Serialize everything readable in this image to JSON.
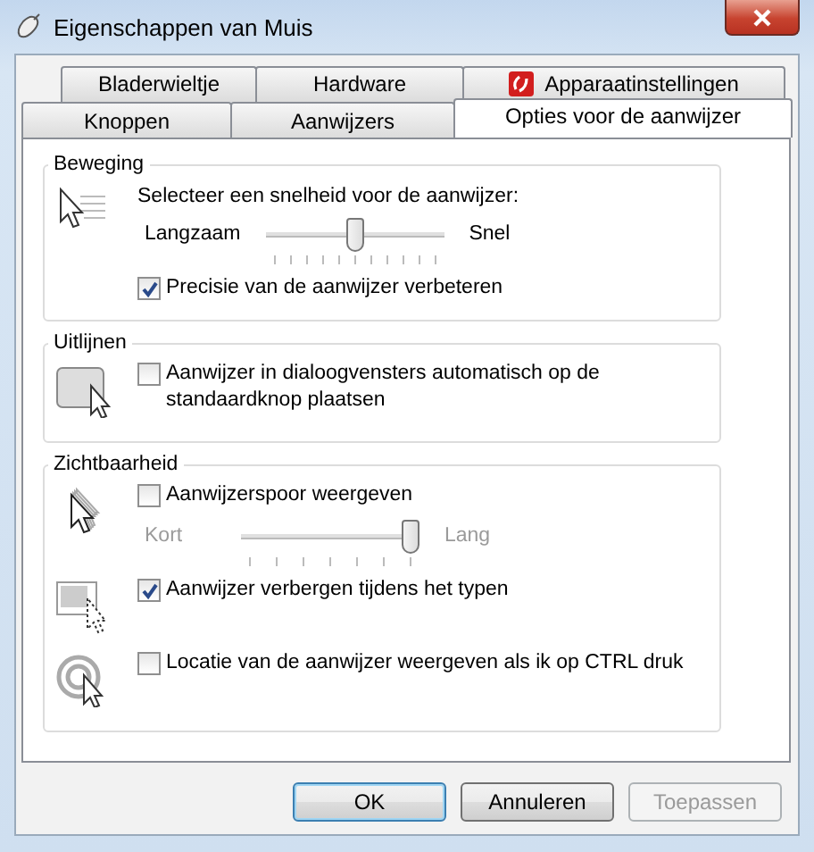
{
  "window": {
    "title": "Eigenschappen van Muis"
  },
  "tab_rows": [
    [
      {
        "label": "Bladerwieltje",
        "selected": false
      },
      {
        "label": "Hardware",
        "selected": false
      },
      {
        "label": "Apparaatinstellingen",
        "selected": false,
        "kind": "icon"
      }
    ],
    [
      {
        "label": "Knoppen",
        "selected": false
      },
      {
        "label": "Aanwijzers",
        "selected": false
      },
      {
        "label": "Opties voor de aanwijzer",
        "selected": true
      }
    ]
  ],
  "sections": [
    {
      "title": "Beweging",
      "groups": [
        [
          {
            "kind": "text",
            "text": "Selecteer een snelheid voor de aanwijzer:"
          },
          {
            "kind": "slider",
            "min_label": "Langzaam",
            "max_label": "Snel",
            "level": 0.5,
            "disabled": false
          },
          {
            "kind": "checkbox",
            "label": "Precisie van de aanwijzer verbeteren",
            "checked": true
          }
        ]
      ]
    },
    {
      "title": "Uitlijnen",
      "groups": [
        [
          {
            "kind": "checkbox",
            "label": "Aanwijzer in dialoogvensters automatisch op de standaardknop plaatsen",
            "checked": false
          }
        ]
      ]
    },
    {
      "title": "Zichtbaarheid",
      "groups": [
        [
          {
            "kind": "checkbox",
            "label": "Aanwijzerspoor weergeven",
            "checked": false
          },
          {
            "kind": "slider",
            "min_label": "Kort",
            "max_label": "Lang",
            "level": 1,
            "disabled": true
          }
        ],
        [
          {
            "kind": "checkbox",
            "label": "Aanwijzer verbergen tijdens het typen",
            "checked": true
          }
        ],
        [
          {
            "kind": "checkbox",
            "label": "Locatie van de aanwijzer weergeven als ik op CTRL druk",
            "checked": false
          }
        ]
      ]
    }
  ],
  "buttons": [
    {
      "label": "OK",
      "default": true,
      "disabled": false
    },
    {
      "label": "Annuleren",
      "default": false,
      "disabled": false
    },
    {
      "label": "Toepassen",
      "default": false,
      "disabled": true
    }
  ]
}
